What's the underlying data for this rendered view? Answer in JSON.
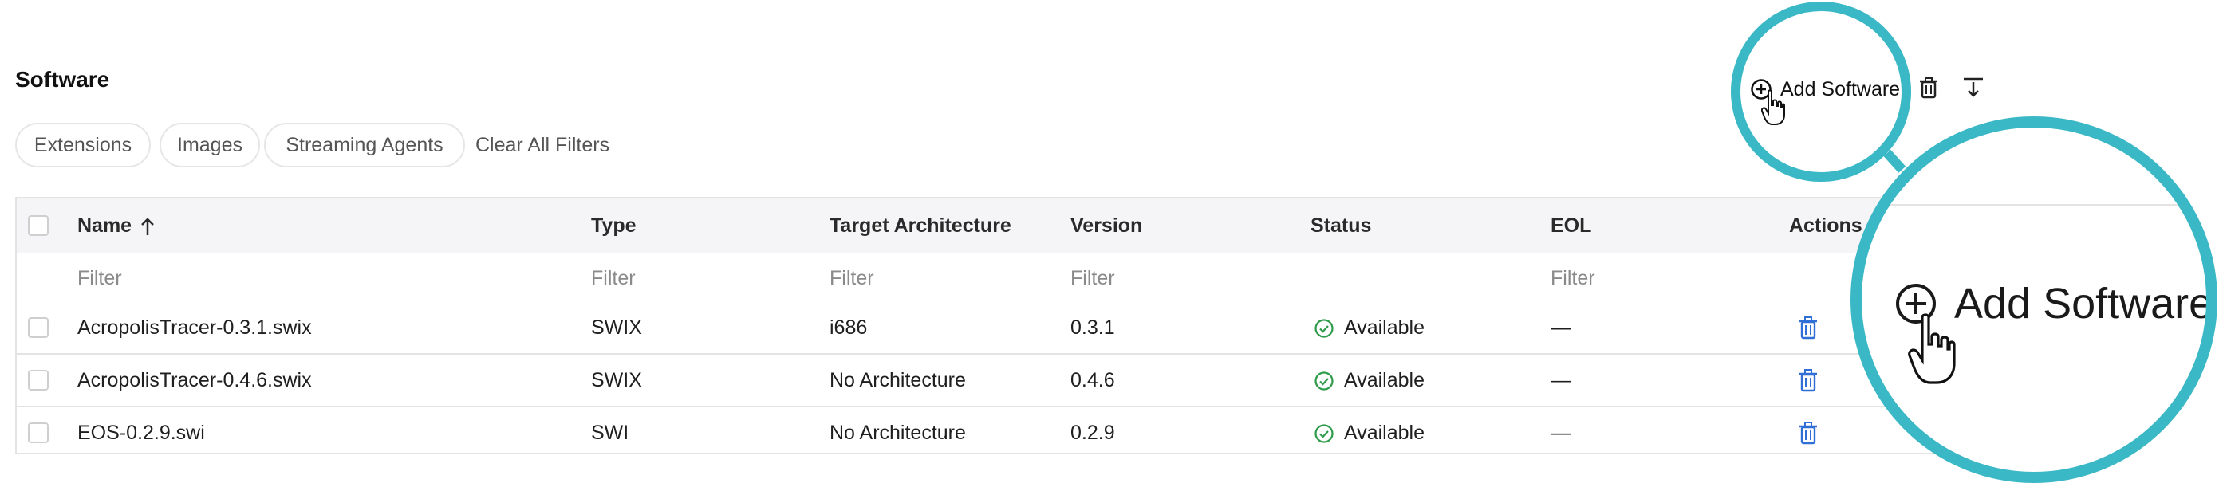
{
  "page": {
    "title": "Software",
    "filters": [
      "Extensions",
      "Images",
      "Streaming Agents"
    ],
    "clear_filters": "Clear All Filters"
  },
  "toolbar": {
    "add_label": "Add Software",
    "add_icon": "plus-circle-icon",
    "delete_icon": "trash-icon",
    "export_icon": "download-icon"
  },
  "table": {
    "headers": {
      "name": "Name",
      "type": "Type",
      "arch": "Target Architecture",
      "version": "Version",
      "status": "Status",
      "eol": "EOL",
      "actions": "Actions"
    },
    "sort_icon": "arrow-up-icon",
    "filter_placeholder": "Filter",
    "rows": [
      {
        "name": "AcropolisTracer-0.3.1.swix",
        "type": "SWIX",
        "arch": "i686",
        "version": "0.3.1",
        "status": "Available",
        "eol": "—"
      },
      {
        "name": "AcropolisTracer-0.4.6.swix",
        "type": "SWIX",
        "arch": "No Architecture",
        "version": "0.4.6",
        "status": "Available",
        "eol": "—"
      },
      {
        "name": "EOS-0.2.9.swi",
        "type": "SWI",
        "arch": "No Architecture",
        "version": "0.2.9",
        "status": "Available",
        "eol": "—"
      }
    ]
  },
  "magnifier": {
    "label": "Add Software"
  },
  "colors": {
    "accent": "#3ab8c6",
    "status_green": "#2e9b4a",
    "action_blue": "#2f6fd6"
  }
}
